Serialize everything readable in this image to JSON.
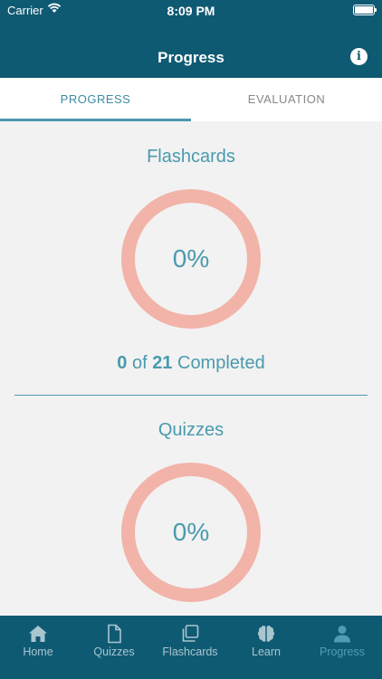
{
  "status_bar": {
    "carrier": "Carrier",
    "time": "8:09 PM"
  },
  "header": {
    "title": "Progress",
    "info_icon": "info-icon"
  },
  "tabs": [
    {
      "label": "PROGRESS",
      "selected": true
    },
    {
      "label": "EVALUATION",
      "selected": false
    }
  ],
  "sections": [
    {
      "title": "Flashcards",
      "percent": 0,
      "percent_label": "0%",
      "completed": "0",
      "of": " of ",
      "total": "21",
      "completed_label": " Completed"
    },
    {
      "title": "Quizzes",
      "percent": 0,
      "percent_label": "0%"
    }
  ],
  "tab_bar": [
    {
      "label": "Home",
      "icon": "home-icon",
      "active": false
    },
    {
      "label": "Quizzes",
      "icon": "document-icon",
      "active": false
    },
    {
      "label": "Flashcards",
      "icon": "cards-icon",
      "active": false
    },
    {
      "label": "Learn",
      "icon": "brain-icon",
      "active": false
    },
    {
      "label": "Progress",
      "icon": "person-icon",
      "active": true
    }
  ],
  "colors": {
    "header": "#0f5a73",
    "accent": "#4a9aae",
    "ring": "#f2b3a8",
    "background": "#f2f2f2"
  }
}
